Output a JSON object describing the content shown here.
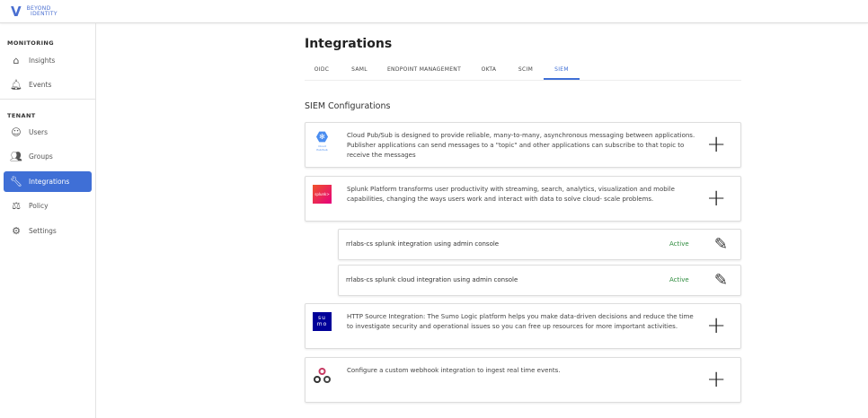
{
  "header": {
    "logo_text_1": "BEYOND",
    "logo_text_2": "IDENTITY"
  },
  "sidebar": {
    "sections": [
      {
        "label": "MONITORING"
      },
      {
        "label": "TENANT"
      }
    ],
    "items": [
      {
        "label": "Insights",
        "icon": "home-icon"
      },
      {
        "label": "Events",
        "icon": "alarm-icon"
      },
      {
        "label": "Users",
        "icon": "face-icon"
      },
      {
        "label": "Groups",
        "icon": "people-icon"
      },
      {
        "label": "Integrations",
        "icon": "wrench-icon",
        "active": true
      },
      {
        "label": "Policy",
        "icon": "gavel-icon"
      },
      {
        "label": "Settings",
        "icon": "gear-icon"
      }
    ]
  },
  "main": {
    "title": "Integrations",
    "tabs": [
      {
        "label": "OIDC"
      },
      {
        "label": "SAML"
      },
      {
        "label": "ENDPOINT MANAGEMENT"
      },
      {
        "label": "OKTA"
      },
      {
        "label": "SCIM"
      },
      {
        "label": "SIEM",
        "active": true
      }
    ],
    "section_title": "SIEM Configurations",
    "cards": [
      {
        "logo": "google-cloud-pubsub-logo",
        "logo_text": "Cloud Pub/Sub",
        "description": "Cloud Pub/Sub is designed to provide reliable, many-to-many, asynchronous messaging between applications. Publisher applications can send messages to a \"topic\" and other applications can subscribe to that topic to receive the messages"
      },
      {
        "logo": "splunk-logo",
        "logo_text": "splunk>",
        "description": "Splunk Platform transforms user productivity with streaming, search, analytics, visualization and mobile capabilities, changing the ways users work and interact with data to solve cloud- scale problems."
      },
      {
        "logo": "sumo-logic-logo",
        "logo_text": "su mo",
        "description": "HTTP Source Integration: The Sumo Logic platform helps you make data-driven decisions and reduce the time to investigate security and operational issues so you can free up resources for more important activities."
      },
      {
        "logo": "webhook-logo",
        "description": "Configure a custom webhook integration to ingest real time events."
      }
    ],
    "splunk_configs": [
      {
        "name": "rrlabs-cs splunk integration using admin console",
        "status": "Active"
      },
      {
        "name": "rrlabs-cs splunk cloud integration using admin console",
        "status": "Active"
      }
    ],
    "status_color": "#2e8b3e",
    "accent_color": "#3f6fd6"
  }
}
